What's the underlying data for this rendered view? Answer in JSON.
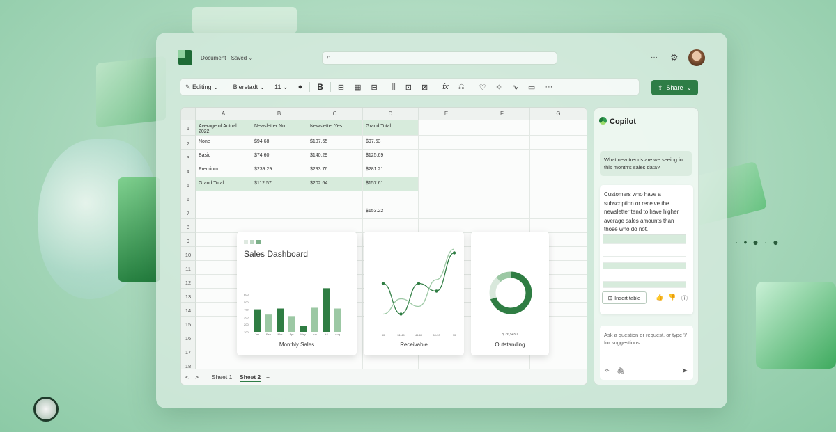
{
  "header": {
    "doc_title": "Document · Saved ⌄",
    "search_icon": "⌕",
    "more": "···",
    "gear": "⚙"
  },
  "ribbon": {
    "editing": "✎ Editing ⌄",
    "font": "Bierstadt ⌄",
    "size": "11 ⌄",
    "color_dot": "●",
    "bold": "B",
    "icon1": "⊞",
    "icon2": "▦",
    "icon3": "⊟",
    "icon4": "⫼",
    "icon5": "⊡",
    "icon6": "⊠",
    "fx": "fx",
    "icon7": "⎌",
    "bulb": "♡",
    "sparkle": "✧",
    "wave": "∿",
    "comment": "▭",
    "more": "···",
    "share": "Share"
  },
  "sheet": {
    "columns": [
      "A",
      "B",
      "C",
      "D",
      "E",
      "F",
      "G"
    ],
    "rows": [
      "1",
      "2",
      "3",
      "4",
      "5",
      "6",
      "7",
      "8",
      "9",
      "10",
      "11",
      "12",
      "13",
      "14",
      "15",
      "16",
      "17",
      "18"
    ],
    "headers": [
      "Average of Actual 2022",
      "Newsletter No",
      "Newsletter Yes",
      "Grand Total"
    ],
    "data": [
      [
        "None",
        "$94.68",
        "$107.65",
        "$97.63"
      ],
      [
        "Basic",
        "$74.60",
        "$140.29",
        "$125.69"
      ],
      [
        "Premium",
        "$239.29",
        "$293.76",
        "$281.21"
      ],
      [
        "Grand Total",
        "$112.57",
        "$202.64",
        "$157.61"
      ]
    ],
    "d7": "$153.22",
    "tabs": {
      "prev": "<",
      "next": ">",
      "sheet1": "Sheet 1",
      "sheet2": "Sheet 2",
      "add": "+"
    }
  },
  "cards": {
    "dashboard_title": "Sales Dashboard",
    "monthly": "Monthly Sales",
    "receivable": "Receivable",
    "outstanding": "Outstanding",
    "outstanding_value": "$ 26,5450"
  },
  "chart_data": [
    {
      "type": "bar",
      "title": "Monthly Sales",
      "categories": [
        "Jan",
        "Feb",
        "Mar",
        "Apr",
        "May",
        "Jun",
        "Jul",
        "Aug"
      ],
      "values": [
        400,
        330,
        410,
        310,
        180,
        420,
        680,
        410
      ],
      "ylim": [
        100,
        600
      ],
      "yticks": [
        "100",
        "200",
        "300",
        "400",
        "500",
        "600"
      ],
      "colors": [
        "#2f7d43",
        "#9cc8a4",
        "#2f7d43",
        "#9cc8a4",
        "#2f7d43",
        "#9cc8a4",
        "#2f7d43",
        "#9cc8a4"
      ]
    },
    {
      "type": "line",
      "title": "Receivable",
      "categories": [
        "30",
        "31-45",
        "46-60",
        "60-90",
        "90"
      ],
      "series": [
        {
          "values": [
            0.55,
            0.15,
            0.55,
            0.45,
            0.95
          ],
          "color": "#2f7d43"
        },
        {
          "values": [
            0.15,
            0.35,
            0.25,
            0.6,
            1.0
          ],
          "color": "#9cc8a4"
        }
      ]
    },
    {
      "type": "pie",
      "title": "Outstanding",
      "values": [
        70,
        18,
        12
      ],
      "colors": [
        "#2f7d43",
        "#d9e8dc",
        "#9cc8a4"
      ]
    }
  ],
  "copilot": {
    "title": "Copilot",
    "question": "What new trends are we seeing in this month's sales data?",
    "answer": "Customers who have a subscription or receive the newsletter tend to have higher average sales amounts than those who do not.",
    "insert": "Insert table",
    "placeholder": "Ask a question or request, or type '/' for suggestions",
    "thumb_up": "👍",
    "thumb_down": "👎",
    "info": "ⓘ",
    "sparkle": "✧",
    "clip": "🖇",
    "send": "➤"
  }
}
